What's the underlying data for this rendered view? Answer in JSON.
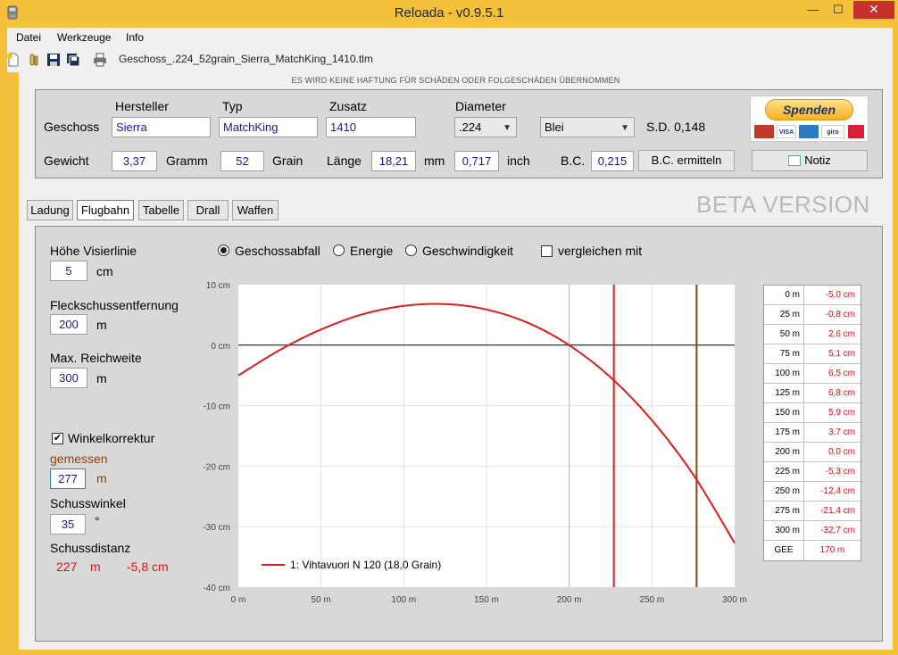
{
  "window": {
    "title": "Reloada - v0.9.5.1",
    "min_glyph": "—",
    "max_glyph": "☐",
    "close_glyph": "✕"
  },
  "menu": [
    "Datei",
    "Werkzeuge",
    "Info"
  ],
  "toolbar": {
    "filename": "Geschoss_.224_52grain_Sierra_MatchKing_1410.tlm"
  },
  "disclaimer": "ES WIRD KEINE HAFTUNG FÜR SCHÄDEN ODER FOLGESCHÄDEN ÜBERNOMMEN",
  "geschoss": {
    "label": "Geschoss",
    "hersteller_label": "Hersteller",
    "hersteller": "Sierra",
    "typ_label": "Typ",
    "typ": "MatchKing",
    "zusatz_label": "Zusatz",
    "zusatz": "1410",
    "diameter_label": "Diameter",
    "diameter": ".224",
    "material": "Blei",
    "sd": "S.D. 0,148"
  },
  "gewicht": {
    "label": "Gewicht",
    "gramm_value": "3,37",
    "gramm_label": "Gramm",
    "grain_value": "52",
    "grain_label": "Grain",
    "laenge_label": "Länge",
    "mm_value": "18,21",
    "mm_label": "mm",
    "inch_value": "0,717",
    "inch_label": "inch",
    "bc_label": "B.C.",
    "bc_value": "0,215",
    "bc_button": "B.C. ermitteln"
  },
  "donate": {
    "label": "Spenden",
    "cards": [
      "MasterCard",
      "VISA",
      "AMEX",
      "giropay",
      "EC"
    ]
  },
  "notiz_button": "Notiz",
  "tabs": [
    "Ladung",
    "Flugbahn",
    "Tabelle",
    "Drall",
    "Waffen"
  ],
  "active_tab": "Flugbahn",
  "beta": "BETA VERSION",
  "left": {
    "visier_label": "Höhe Visierlinie",
    "visier_value": "5",
    "visier_unit": "cm",
    "fleck_label": "Fleckschussentfernung",
    "fleck_value": "200",
    "fleck_unit": "m",
    "reich_label": "Max. Reichweite",
    "reich_value": "300",
    "reich_unit": "m",
    "winkel_label": "Winkelkorrektur",
    "winkel_checked": true,
    "gemessen_label": "gemessen",
    "gemessen_value": "277",
    "gemessen_unit": "m",
    "schusswinkel_label": "Schusswinkel",
    "schusswinkel_value": "35",
    "schusswinkel_unit": "°",
    "schussdistanz_label": "Schussdistanz",
    "schussdistanz_m": "227",
    "schussdistanz_m_unit": "m",
    "schussdistanz_cm": "-5,8 cm"
  },
  "options": {
    "radio": [
      "Geschossabfall",
      "Energie",
      "Geschwindigkeit"
    ],
    "selected": "Geschossabfall",
    "vergleichen_label": "vergleichen mit",
    "vergleichen_checked": false
  },
  "chart_data": {
    "type": "line",
    "x_ticks": [
      "0 m",
      "50 m",
      "100 m",
      "150 m",
      "200 m",
      "250 m",
      "300 m"
    ],
    "y_ticks": [
      "10 cm",
      "0 cm",
      "-10 cm",
      "-20 cm",
      "-30 cm",
      "-40 cm"
    ],
    "xlim": [
      0,
      300
    ],
    "ylim": [
      -40,
      10
    ],
    "grid": true,
    "series": [
      {
        "name": "1: Vihtavuori N 120 (18,0 Grain)",
        "color": "#e21b1b",
        "x": [
          0,
          25,
          50,
          75,
          100,
          125,
          150,
          175,
          200,
          225,
          250,
          275,
          300
        ],
        "y": [
          -5.0,
          -0.8,
          2.6,
          5.1,
          6.5,
          6.8,
          5.9,
          3.7,
          0.0,
          -5.3,
          -12.4,
          -21.4,
          -32.7
        ]
      }
    ],
    "vertical_markers": [
      {
        "x": 227,
        "color": "#e21b1b"
      },
      {
        "x": 277,
        "color": "#8c4510"
      }
    ],
    "legend_position": "bottom-left"
  },
  "table": {
    "rows": [
      [
        "0 m",
        "-5,0 cm"
      ],
      [
        "25 m",
        "-0,8 cm"
      ],
      [
        "50 m",
        "2,6 cm"
      ],
      [
        "75 m",
        "5,1 cm"
      ],
      [
        "100 m",
        "6,5 cm"
      ],
      [
        "125 m",
        "6,8 cm"
      ],
      [
        "150 m",
        "5,9 cm"
      ],
      [
        "175 m",
        "3,7 cm"
      ],
      [
        "200 m",
        "0,0 cm"
      ],
      [
        "225 m",
        "-5,3 cm"
      ],
      [
        "250 m",
        "-12,4 cm"
      ],
      [
        "275 m",
        "-21,4 cm"
      ],
      [
        "300 m",
        "-32,7 cm"
      ],
      [
        "GEE",
        "170 m"
      ]
    ]
  }
}
